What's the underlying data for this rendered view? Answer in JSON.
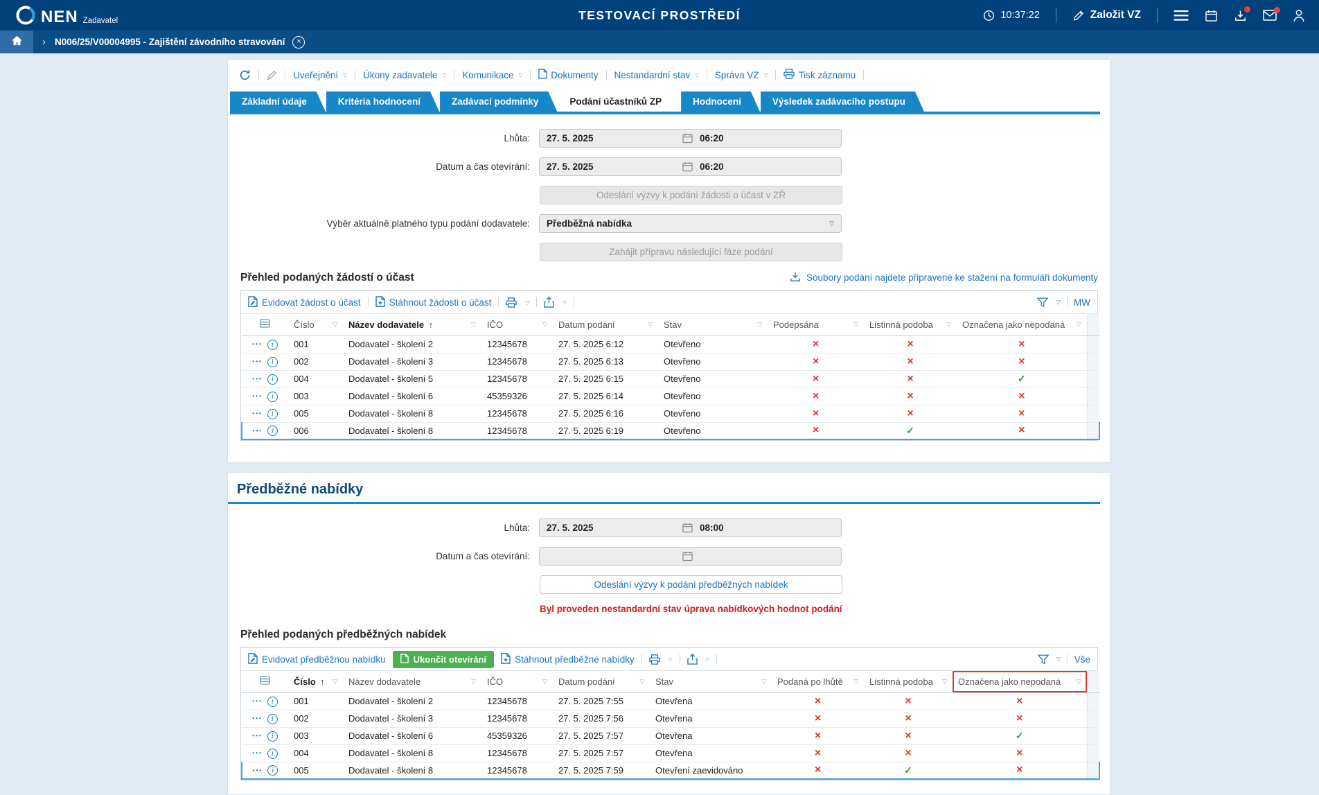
{
  "header": {
    "brand": "NEN",
    "brand_sub": "Zadavatel",
    "title": "TESTOVACÍ PROSTŘEDÍ",
    "time": "10:37:22",
    "create_vz": "Založit VZ"
  },
  "breadcrumb": {
    "record": "N006/25/V00004995 - Zajištění závodního stravování"
  },
  "record_toolbar": {
    "menus": [
      {
        "label": "Uveřejnění",
        "dropdown": true
      },
      {
        "label": "Úkony zadavatele",
        "dropdown": true
      },
      {
        "label": "Komunikace",
        "dropdown": true
      },
      {
        "label": "Dokumenty",
        "dropdown": false
      },
      {
        "label": "Nestandardní stav",
        "dropdown": true
      },
      {
        "label": "Správa VZ",
        "dropdown": true
      },
      {
        "label": "Tisk záznamu",
        "dropdown": false
      }
    ]
  },
  "tabs": {
    "items": [
      "Základní údaje",
      "Kritéria hodnocení",
      "Zadávací podmínky",
      "Podání účastníků ZP",
      "Hodnocení",
      "Výsledek zadávacího postupu"
    ],
    "active": "Podání účastníků ZP"
  },
  "phase1": {
    "deadline_label": "Lhůta:",
    "deadline_date": "27. 5. 2025",
    "deadline_time": "06:20",
    "opening_label": "Datum a čas otevírání:",
    "opening_date": "27. 5. 2025",
    "opening_time": "06:20",
    "send_invite_button": "Odeslání výzvy k podání žádosti o účast v ZŘ",
    "submission_type_label": "Výběr aktuálně platného typu podání dodavatele:",
    "submission_type_value": "Předběžná nabídka",
    "start_next_phase_button": "Zahájit přípravu následující fáze podání"
  },
  "requests": {
    "heading": "Přehled podaných žádostí o účast",
    "files_hint": "Soubory podání najdete připravené ke stažení na formuláři dokumenty",
    "actions": {
      "register": "Evidovat žádost o účast",
      "download": "Stáhnout žádosti o účast",
      "view": "MW"
    },
    "table": {
      "columns": [
        {
          "label": "Číslo"
        },
        {
          "label": "Název dodavatele",
          "sort": "asc"
        },
        {
          "label": "IČO"
        },
        {
          "label": "Datum podání"
        },
        {
          "label": "Stav"
        },
        {
          "label": "Podepsána"
        },
        {
          "label": "Listinná podoba"
        },
        {
          "label": "Označena jako nepodaná"
        }
      ],
      "rows": [
        {
          "cells": [
            "001",
            "Dodavatel - školení 2",
            "12345678",
            "27. 5. 2025 6:12",
            "Otevřeno"
          ],
          "flags": [
            false,
            false,
            false
          ]
        },
        {
          "cells": [
            "002",
            "Dodavatel - školení 3",
            "12345678",
            "27. 5. 2025 6:13",
            "Otevřeno"
          ],
          "flags": [
            false,
            false,
            false
          ]
        },
        {
          "cells": [
            "004",
            "Dodavatel - školení 5",
            "12345678",
            "27. 5. 2025 6:15",
            "Otevřeno"
          ],
          "flags": [
            false,
            false,
            true
          ]
        },
        {
          "cells": [
            "003",
            "Dodavatel - školení 6",
            "45359326",
            "27. 5. 2025 6:14",
            "Otevřeno"
          ],
          "flags": [
            false,
            false,
            false
          ]
        },
        {
          "cells": [
            "005",
            "Dodavatel - školení 8",
            "12345678",
            "27. 5. 2025 6:16",
            "Otevřeno"
          ],
          "flags": [
            false,
            false,
            false
          ]
        },
        {
          "cells": [
            "006",
            "Dodavatel - školení 8",
            "12345678",
            "27. 5. 2025 6:19",
            "Otevřeno"
          ],
          "flags": [
            false,
            true,
            false
          ],
          "selected": true
        }
      ]
    }
  },
  "preliminary": {
    "heading": "Předběžné nabídky",
    "deadline_label": "Lhůta:",
    "deadline_date": "27. 5. 2025",
    "deadline_time": "08:00",
    "opening_label": "Datum a čas otevírání:",
    "opening_date": "",
    "opening_time": "",
    "send_invite_button": "Odeslání výzvy k podání předběžných nabídek",
    "warning": "Byl proveden nestandardní stav úprava nabídkových hodnot podání",
    "subheading": "Přehled podaných předběžných nabídek",
    "actions": {
      "register": "Evidovat předběžnou nabídku",
      "finish_opening": "Ukončit otevírání",
      "download": "Stáhnout předběžné nabídky",
      "view": "Vše"
    },
    "table": {
      "columns": [
        {
          "label": "Číslo",
          "sort": "asc"
        },
        {
          "label": "Název dodavatele"
        },
        {
          "label": "IČO"
        },
        {
          "label": "Datum podání"
        },
        {
          "label": "Stav"
        },
        {
          "label": "Podaná po lhůtě"
        },
        {
          "label": "Listinná podoba"
        },
        {
          "label": "Označena jako nepodaná",
          "highlight": true
        }
      ],
      "rows": [
        {
          "cells": [
            "001",
            "Dodavatel - školení 2",
            "12345678",
            "27. 5. 2025 7:55",
            "Otevřena"
          ],
          "flags": [
            false,
            false,
            false
          ]
        },
        {
          "cells": [
            "002",
            "Dodavatel - školení 3",
            "12345678",
            "27. 5. 2025 7:56",
            "Otevřena"
          ],
          "flags": [
            false,
            false,
            false
          ]
        },
        {
          "cells": [
            "003",
            "Dodavatel - školení 6",
            "45359326",
            "27. 5. 2025 7:57",
            "Otevřena"
          ],
          "flags": [
            false,
            false,
            true
          ]
        },
        {
          "cells": [
            "004",
            "Dodavatel - školení 8",
            "12345678",
            "27. 5. 2025 7:57",
            "Otevřena"
          ],
          "flags": [
            false,
            false,
            false
          ]
        },
        {
          "cells": [
            "005",
            "Dodavatel - školení 8",
            "12345678",
            "27. 5. 2025 7:59",
            "Otevření zaevidováno"
          ],
          "flags": [
            false,
            true,
            false
          ],
          "selected": true
        }
      ]
    }
  },
  "icons": {
    "dropdown": "▽",
    "filter": "▽",
    "sort_asc": "↑",
    "cross": "×",
    "check": "✓",
    "row_menu": "•••",
    "info": "i",
    "breadcrumb_chevron": "›",
    "close": "×"
  },
  "colors": {
    "header_bg": "#00417c",
    "accent_blue": "#1787c8",
    "link_blue": "#1a74c2",
    "success_green": "#2f9e33",
    "danger_red": "#dd3430",
    "button_green": "#4caf50"
  }
}
